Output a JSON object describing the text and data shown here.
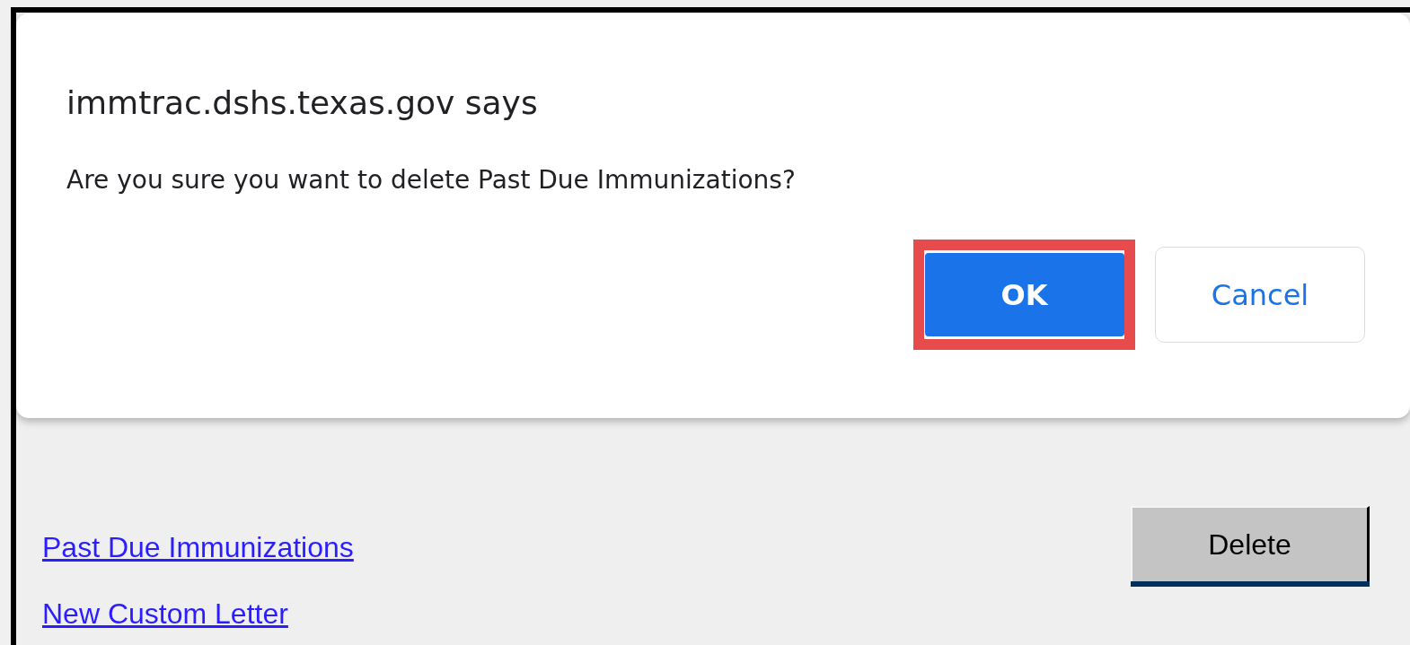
{
  "dialog": {
    "title": "immtrac.dshs.texas.gov says",
    "message": "Are you sure you want to delete Past Due Immunizations?",
    "buttons": [
      {
        "label": "OK",
        "kind": "primary",
        "highlighted": true
      },
      {
        "label": "Cancel",
        "kind": "secondary",
        "highlighted": false
      }
    ]
  },
  "links": [
    "Past Due Immunizations",
    "New Custom Letter"
  ],
  "delete_button": "Delete"
}
